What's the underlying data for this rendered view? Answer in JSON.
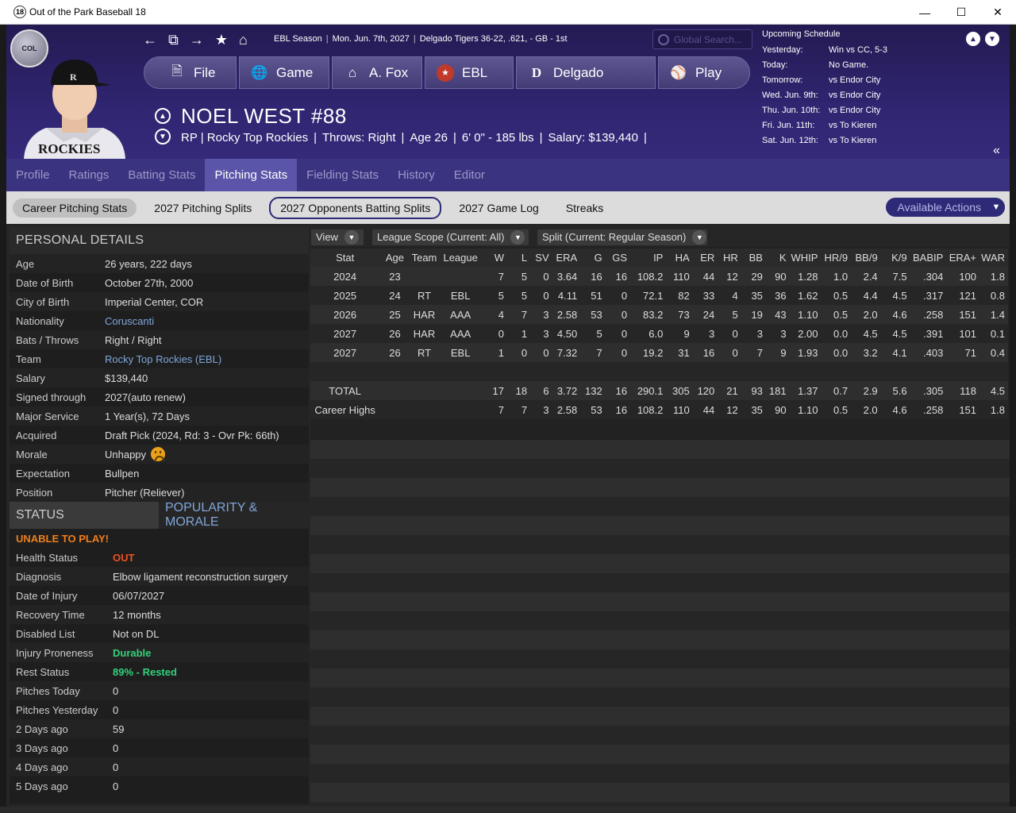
{
  "window": {
    "title": "Out of the Park Baseball 18",
    "app_icon": "18"
  },
  "header": {
    "season": "EBL Season",
    "date": "Mon. Jun. 7th, 2027",
    "team_record": "Delgado Tigers  36-22, .621, - GB - 1st",
    "search_placeholder": "Global Search...",
    "buttons": [
      {
        "label": "File",
        "icon": "file-icon"
      },
      {
        "label": "Game",
        "icon": "globe-icon"
      },
      {
        "label": "A. Fox",
        "icon": "home-icon"
      },
      {
        "label": "EBL",
        "icon": "league-logo-icon"
      },
      {
        "label": "Delgado",
        "icon": "tigers-logo-icon"
      },
      {
        "label": "Play",
        "icon": "baseball-icon"
      }
    ],
    "player_name": "NOEL WEST  #88",
    "player_info": {
      "pos_team": "RP | Rocky Top Rockies",
      "throws": "Throws: Right",
      "age": "Age 26",
      "size": "6' 0\" - 185 lbs",
      "salary": "Salary: $139,440"
    },
    "jersey_text": "ROCKIES"
  },
  "schedule": {
    "title": "Upcoming Schedule",
    "rows": [
      {
        "day": "Yesterday:",
        "game": "Win vs CC, 5-3"
      },
      {
        "day": "Today:",
        "game": "No Game."
      },
      {
        "day": "Tomorrow:",
        "game": "vs Endor City"
      },
      {
        "day": "Wed. Jun. 9th:",
        "game": "vs Endor City"
      },
      {
        "day": "Thu. Jun. 10th:",
        "game": "vs Endor City"
      },
      {
        "day": "Fri. Jun. 11th:",
        "game": "vs To Kieren"
      },
      {
        "day": "Sat. Jun. 12th:",
        "game": "vs To Kieren"
      }
    ]
  },
  "tabs": [
    "Profile",
    "Ratings",
    "Batting Stats",
    "Pitching Stats",
    "Fielding Stats",
    "History",
    "Editor"
  ],
  "active_tab": "Pitching Stats",
  "subtabs": [
    "Career Pitching Stats",
    "2027 Pitching Splits",
    "2027 Opponents Batting Splits",
    "2027 Game Log",
    "Streaks"
  ],
  "available_actions": "Available Actions",
  "personal": {
    "title": "PERSONAL DETAILS",
    "rows": [
      {
        "k": "Age",
        "v": "26 years, 222 days"
      },
      {
        "k": "Date of Birth",
        "v": "October 27th, 2000"
      },
      {
        "k": "City of Birth",
        "v": "Imperial Center, COR"
      },
      {
        "k": "Nationality",
        "v": "Coruscanti"
      },
      {
        "k": "Bats / Throws",
        "v": "Right / Right"
      },
      {
        "k": "Team",
        "v": "Rocky Top Rockies (EBL)"
      },
      {
        "k": "Salary",
        "v": "$139,440"
      },
      {
        "k": "Signed through",
        "v": "2027(auto renew)"
      },
      {
        "k": "Major Service",
        "v": "1 Year(s), 72 Days"
      },
      {
        "k": "Acquired",
        "v": "Draft Pick (2024, Rd: 3 - Ovr Pk: 66th)"
      },
      {
        "k": "Morale",
        "v": "Unhappy"
      },
      {
        "k": "Expectation",
        "v": "Bullpen"
      },
      {
        "k": "Position",
        "v": "Pitcher (Reliever)"
      }
    ]
  },
  "status": {
    "title": "STATUS",
    "tab2": "POPULARITY & MORALE",
    "alert": "UNABLE TO PLAY!",
    "rows": [
      {
        "k": "Health Status",
        "v": "OUT"
      },
      {
        "k": "Diagnosis",
        "v": "Elbow ligament reconstruction surgery"
      },
      {
        "k": "Date of Injury",
        "v": "06/07/2027"
      },
      {
        "k": "Recovery Time",
        "v": "12 months"
      },
      {
        "k": "Disabled List",
        "v": "Not on DL"
      },
      {
        "k": "Injury Proneness",
        "v": "Durable"
      },
      {
        "k": "Rest Status",
        "v": "89% - Rested"
      },
      {
        "k": "Pitches Today",
        "v": "0"
      },
      {
        "k": "Pitches Yesterday",
        "v": "0"
      },
      {
        "k": "2 Days ago",
        "v": "59"
      },
      {
        "k": "3 Days ago",
        "v": "0"
      },
      {
        "k": "4 Days ago",
        "v": "0"
      },
      {
        "k": "5 Days ago",
        "v": "0"
      }
    ]
  },
  "filters": {
    "view": "View",
    "scope": "League Scope  (Current: All)",
    "split": "Split  (Current: Regular Season)"
  },
  "stats": {
    "columns": [
      "Stat",
      "Age",
      "Team",
      "League",
      "W",
      "L",
      "SV",
      "ERA",
      "G",
      "GS",
      "IP",
      "HA",
      "ER",
      "HR",
      "BB",
      "K",
      "WHIP",
      "HR/9",
      "BB/9",
      "K/9",
      "BABIP",
      "ERA+",
      "WAR"
    ],
    "rows": [
      [
        "2024",
        "23",
        "",
        "",
        "7",
        "5",
        "0",
        "3.64",
        "16",
        "16",
        "108.2",
        "110",
        "44",
        "12",
        "29",
        "90",
        "1.28",
        "1.0",
        "2.4",
        "7.5",
        ".304",
        "100",
        "1.8"
      ],
      [
        "2025",
        "24",
        "RT",
        "EBL",
        "5",
        "5",
        "0",
        "4.11",
        "51",
        "0",
        "72.1",
        "82",
        "33",
        "4",
        "35",
        "36",
        "1.62",
        "0.5",
        "4.4",
        "4.5",
        ".317",
        "121",
        "0.8"
      ],
      [
        "2026",
        "25",
        "HAR",
        "AAA",
        "4",
        "7",
        "3",
        "2.58",
        "53",
        "0",
        "83.2",
        "73",
        "24",
        "5",
        "19",
        "43",
        "1.10",
        "0.5",
        "2.0",
        "4.6",
        ".258",
        "151",
        "1.4"
      ],
      [
        "2027",
        "26",
        "HAR",
        "AAA",
        "0",
        "1",
        "3",
        "4.50",
        "5",
        "0",
        "6.0",
        "9",
        "3",
        "0",
        "3",
        "3",
        "2.00",
        "0.0",
        "4.5",
        "4.5",
        ".391",
        "101",
        "0.1"
      ],
      [
        "2027",
        "26",
        "RT",
        "EBL",
        "1",
        "0",
        "0",
        "7.32",
        "7",
        "0",
        "19.2",
        "31",
        "16",
        "0",
        "7",
        "9",
        "1.93",
        "0.0",
        "3.2",
        "4.1",
        ".403",
        "71",
        "0.4"
      ],
      [
        "",
        "",
        "",
        "",
        "",
        "",
        "",
        "",
        "",
        "",
        "",
        "",
        "",
        "",
        "",
        "",
        "",
        "",
        "",
        "",
        "",
        "",
        ""
      ],
      [
        "TOTAL",
        "",
        "",
        "",
        "17",
        "18",
        "6",
        "3.72",
        "132",
        "16",
        "290.1",
        "305",
        "120",
        "21",
        "93",
        "181",
        "1.37",
        "0.7",
        "2.9",
        "5.6",
        ".305",
        "118",
        "4.5"
      ],
      [
        "Career Highs",
        "",
        "",
        "",
        "7",
        "7",
        "3",
        "2.58",
        "53",
        "16",
        "108.2",
        "110",
        "44",
        "12",
        "35",
        "90",
        "1.10",
        "0.5",
        "2.0",
        "4.6",
        ".258",
        "151",
        "1.8"
      ]
    ]
  }
}
